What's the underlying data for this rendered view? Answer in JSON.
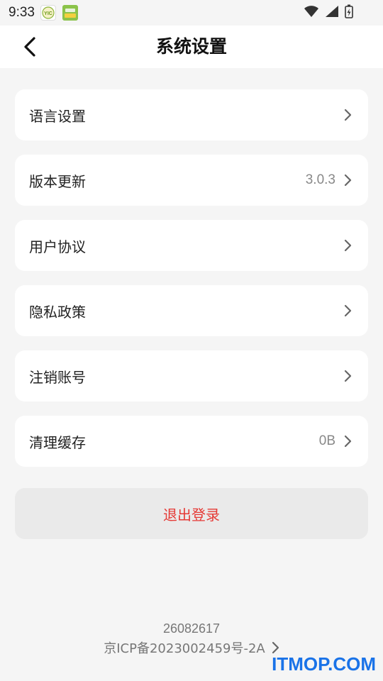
{
  "status_bar": {
    "time": "9:33",
    "app_icons": [
      "yic-app-icon",
      "green-app-icon"
    ]
  },
  "header": {
    "title": "系统设置"
  },
  "menu": [
    {
      "label": "语言设置",
      "value": ""
    },
    {
      "label": "版本更新",
      "value": "3.0.3"
    },
    {
      "label": "用户协议",
      "value": ""
    },
    {
      "label": "隐私政策",
      "value": ""
    },
    {
      "label": "注销账号",
      "value": ""
    },
    {
      "label": "清理缓存",
      "value": "0B"
    }
  ],
  "logout": {
    "label": "退出登录",
    "color": "#e53935"
  },
  "footer": {
    "id": "26082617",
    "icp": "京ICP备2023002459号-2A"
  },
  "watermark": "ITMOP.COM"
}
